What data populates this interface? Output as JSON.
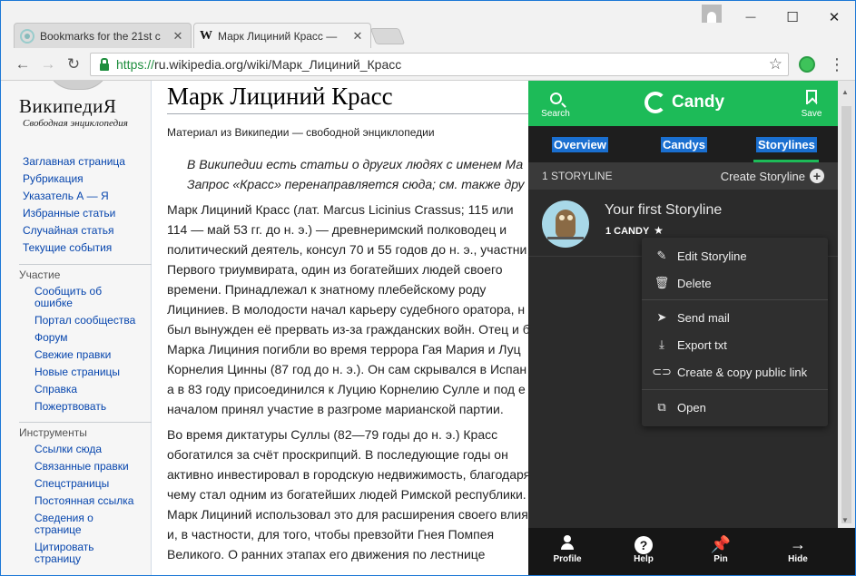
{
  "browser": {
    "tabs": [
      {
        "title": "Bookmarks for the 21st c",
        "close": "✕"
      },
      {
        "title": "Марк Лициний Красс —",
        "close": "✕",
        "favicon": "W"
      }
    ],
    "url_prefix": "https://",
    "url_rest": "ru.wikipedia.org/wiki/Марк_Лициний_Красс",
    "window_controls": {
      "minimize": "—",
      "maximize": "☐",
      "close": "✕"
    }
  },
  "wiki": {
    "wordmark": "ВикипедиЯ",
    "tagline": "Свободная энциклопедия",
    "nav": [
      "Заглавная страница",
      "Рубрикация",
      "Указатель А — Я",
      "Избранные статьи",
      "Случайная статья",
      "Текущие события"
    ],
    "participation": {
      "heading": "Участие",
      "items": [
        "Сообщить об ошибке",
        "Портал сообщества",
        "Форум",
        "Свежие правки",
        "Новые страницы",
        "Справка",
        "Пожертвовать"
      ]
    },
    "tools": {
      "heading": "Инструменты",
      "items": [
        "Ссылки сюда",
        "Связанные правки",
        "Спецстраницы",
        "Постоянная ссылка",
        "Сведения о странице",
        "Цитировать страницу"
      ]
    }
  },
  "article": {
    "title": "Марк Лициний Красс",
    "subtitle": "Материал из Википедии — свободной энциклопедии",
    "hatnote_1": "В Википедии есть статьи о других людях с именем Ма",
    "hatnote_2": "Запрос «Красс» перенаправляется сюда; см. также дру",
    "p1": [
      "Марк Лициний Красс (лат. Marcus Licinius Crassus; 115 или",
      "114 — май 53 гг. до н. э.) — древнеримский полководец и",
      "политический деятель, консул 70 и 55 годов до н. э., участни",
      "Первого триумвирата, один из богатейших людей своего",
      "времени. Принадлежал к знатному плебейскому роду",
      "Лициниев. В молодости начал карьеру судебного оратора, н",
      "был вынужден её прервать из-за гражданских войн. Отец и б",
      "Марка Лициния погибли во время террора Гая Мария и Луц",
      "Корнелия Цинны (87 год до н. э.). Он сам скрывался в Испан",
      "а в 83 году присоединился к Луцию Корнелию Сулле и под е",
      "началом принял участие в разгроме марианской партии."
    ],
    "p2": [
      "Во время диктатуры Суллы (82—79 годы до н. э.) Красс",
      "обогатился за счёт проскрипций. В последующие годы он",
      "активно инвестировал в городскую недвижимость, благодаря",
      "чему стал одним из богатейших людей Римской республики.",
      "Марк Лициний использовал это для расширения своего влия",
      "и, в частности, для того, чтобы превзойти Гнея Помпея",
      "Великого. О ранних этапах его движения по лестнице"
    ]
  },
  "candy": {
    "header": {
      "search": "Search",
      "brand": "Candy",
      "save": "Save"
    },
    "tabs": {
      "overview": "Overview",
      "candys": "Candys",
      "storylines": "Storylines"
    },
    "storyline_count": "1 STORYLINE",
    "create": "Create Storyline",
    "story": {
      "title": "Your first Storyline",
      "count": "1 CANDY"
    },
    "menu": {
      "edit": "Edit Storyline",
      "delete": "Delete",
      "send": "Send mail",
      "export": "Export txt",
      "copy_link": "Create & copy public link",
      "open": "Open"
    },
    "bottom": {
      "profile": "Profile",
      "help": "Help",
      "pin": "Pin",
      "hide": "Hide"
    },
    "colors": {
      "accent": "#1dbb58",
      "tab_highlight": "#1a6fd0",
      "panel": "#2b2b2b"
    }
  }
}
